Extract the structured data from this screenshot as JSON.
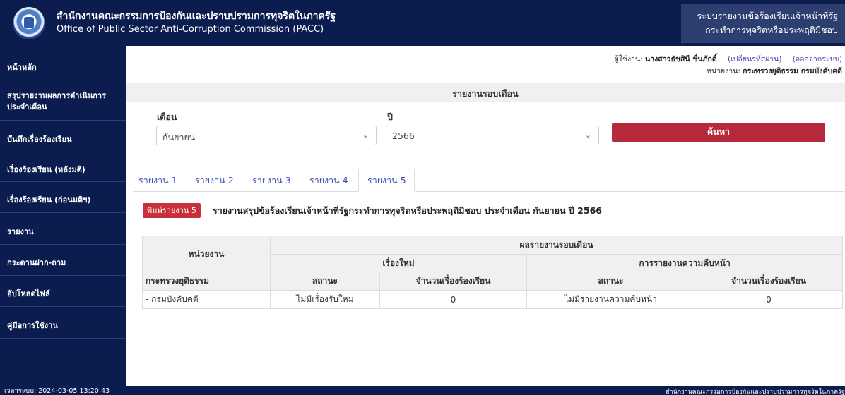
{
  "header": {
    "title_th": "สำนักงานคณะกรรมการป้องกันและปราบปรามการทุจริตในภาครัฐ",
    "title_en": "Office of Public Sector Anti-Corruption Commission (PACC)",
    "system_line1": "ระบบรายงานข้อร้องเรียนเจ้าหน้าที่รัฐ",
    "system_line2": "กระทำการทุจริตหรือประพฤติมิชอบ"
  },
  "sidebar": {
    "items": [
      {
        "label": "หน้าหลัก"
      },
      {
        "label": "สรุปรายงานผลการดำเนินการ"
      },
      {
        "label": "ประจำเดือน"
      },
      {
        "label": "บันทึกเรื่องร้องเรียน"
      },
      {
        "label": "เรื่องร้องเรียน (หลังมติ)"
      },
      {
        "label": "เรื่องร้องเรียน (ก่อนมติฯ)"
      },
      {
        "label": "รายงาน"
      },
      {
        "label": "กระดานฝาก-ถาม"
      },
      {
        "label": "อัปโหลดไฟล์"
      },
      {
        "label": "คู่มือการใช้งาน"
      }
    ],
    "server_time": "เวลาระบบ: 2024-03-05 13:20:43"
  },
  "user": {
    "user_label": "ผู้ใช้งาน:",
    "user_name": "นางสาวธัชสินี ชื่นภักดิ์",
    "change_password": "(เปลี่ยนรหัสผ่าน)",
    "logout": "(ออกจากระบบ)",
    "agency_label": "หน่วยงาน:",
    "agency_name": "กระทรวงยุติธรรม กรมบังคับคดี"
  },
  "report": {
    "band_title": "รายงานรอบเดือน",
    "month_label": "เดือน",
    "month_value": "กันยายน",
    "year_label": "ปี",
    "year_value": "2566",
    "search_label": "ค้นหา"
  },
  "tabs": [
    {
      "label": "รายงาน 1"
    },
    {
      "label": "รายงาน 2"
    },
    {
      "label": "รายงาน 3"
    },
    {
      "label": "รายงาน 4"
    },
    {
      "label": "รายงาน 5"
    }
  ],
  "print": {
    "button_label": "พิมพ์รายงาน 5",
    "title": "รายงานสรุปข้อร้องเรียนเจ้าหน้าที่รัฐกระทำการทุจริตหรือประพฤติมิชอบ ประจำเดือน กันยายน ปี 2566"
  },
  "table": {
    "h_unit": "หน่วยงาน",
    "h_result": "ผลรายงานรอบเดือน",
    "h_new": "เรื่องใหม่",
    "h_progress": "การรายงานความคืบหน้า",
    "sub_status_1": "สถานะ",
    "sub_count_1": "จำนวนเรื่องร้องเรียน",
    "sub_status_2": "สถานะ",
    "sub_count_2": "จำนวนเรื่องร้องเรียน",
    "ministry": "กระทรวงยุติธรรม",
    "row": {
      "dept": "- กรมบังคับคดี",
      "new_status": "ไม่มีเรื่องรับใหม่",
      "new_count": "0",
      "progress_status": "ไม่มีรายงานความคืบหน้า",
      "progress_count": "0"
    }
  },
  "footer": {
    "text": "สำนักงานคณะกรรมการป้องกันและปราบปรามการทุจริตในภาครัฐ"
  }
}
